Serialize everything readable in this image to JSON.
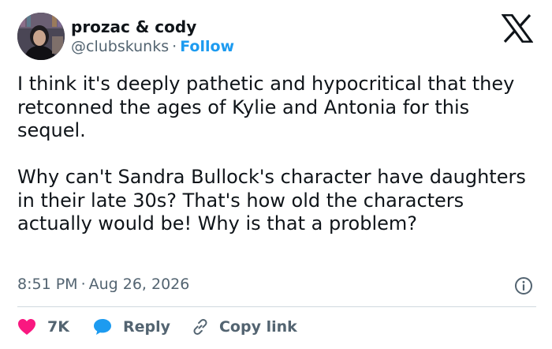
{
  "author": {
    "display_name": "prozac & cody",
    "handle": "@clubskunks",
    "separator": "·",
    "follow_label": "Follow"
  },
  "tweet": {
    "paragraphs": [
      "I think it's deeply pathetic and hypocritical that they retconned the ages of Kylie and Antonia for this sequel.",
      "Why can't Sandra Bullock's character have daughters in their late 30s? That's how old the characters actually would be! Why is that a problem?"
    ],
    "time": "8:51 PM",
    "separator": "·",
    "date": "Aug 26, 2026"
  },
  "actions": {
    "likes_count": "7K",
    "reply_label": "Reply",
    "copy_link_label": "Copy link"
  },
  "icons": {
    "brand": "x-logo-icon",
    "info": "info-icon",
    "like": "heart-icon",
    "reply": "speech-bubble-icon",
    "copy_link": "link-icon"
  },
  "colors": {
    "text": "#0f1419",
    "secondary": "#536471",
    "link": "#1d9bf0",
    "like": "#f91880",
    "reply": "#1d9bf0",
    "divider": "#cfd9de"
  }
}
